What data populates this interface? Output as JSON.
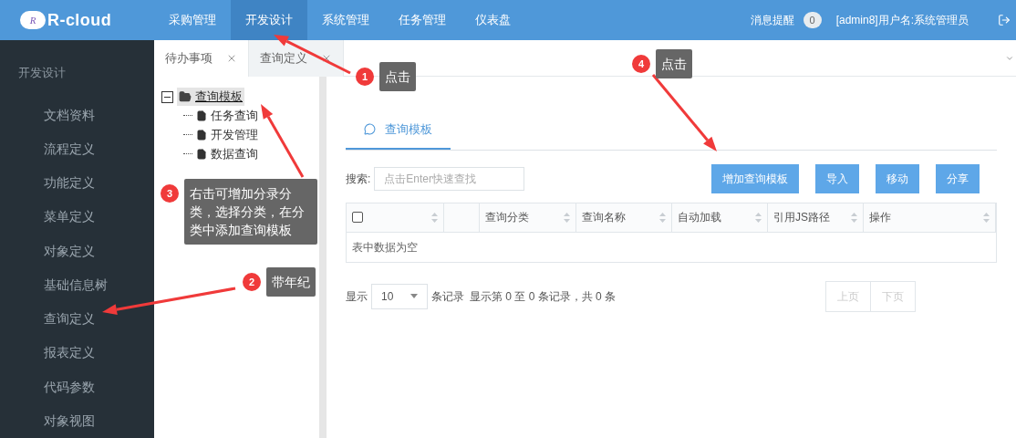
{
  "header": {
    "logo": {
      "mark": "R",
      "name": "R-cloud"
    },
    "nav": [
      {
        "label": "采购管理",
        "selected": false
      },
      {
        "label": "开发设计",
        "selected": true
      },
      {
        "label": "系统管理",
        "selected": false
      },
      {
        "label": "任务管理",
        "selected": false
      },
      {
        "label": "仪表盘",
        "selected": false
      }
    ],
    "notice": {
      "label": "消息提醒",
      "count": "0"
    },
    "user": "[admin8]用户名:系统管理员"
  },
  "sidebar": {
    "title": "开发设计",
    "items": [
      {
        "label": "文档资料"
      },
      {
        "label": "流程定义"
      },
      {
        "label": "功能定义"
      },
      {
        "label": "菜单定义"
      },
      {
        "label": "对象定义"
      },
      {
        "label": "基础信息树"
      },
      {
        "label": "查询定义"
      },
      {
        "label": "报表定义"
      },
      {
        "label": "代码参数"
      },
      {
        "label": "对象视图"
      }
    ]
  },
  "tabs": [
    {
      "label": "待办事项",
      "selected": false
    },
    {
      "label": "查询定义",
      "selected": true
    }
  ],
  "tree": {
    "label": "查询模板",
    "expanded": true,
    "selected": true,
    "children": [
      {
        "label": "任务查询"
      },
      {
        "label": "开发管理"
      },
      {
        "label": "数据查询"
      }
    ]
  },
  "panel": {
    "tab": "查询模板",
    "search": {
      "label": "搜索:",
      "placeholder": "点击Enter快速查找"
    },
    "buttons": [
      "增加查询模板",
      "导入",
      "移动",
      "分享"
    ],
    "table": {
      "columns": [
        {
          "kind": "checkbox",
          "checked": false
        },
        {
          "kind": "blank"
        },
        {
          "label": "查询分类",
          "kind": "text"
        },
        {
          "label": "查询名称",
          "kind": "text"
        },
        {
          "label": "自动加载",
          "kind": "text"
        },
        {
          "label": "引用JS路径",
          "kind": "text"
        },
        {
          "label": "操作",
          "kind": "text"
        }
      ],
      "empty": "表中数据为空"
    },
    "pager": {
      "show": "显示",
      "size": "10",
      "unit": "条记录",
      "info": "显示第 0 至 0 条记录，共 0 条",
      "prev": {
        "label": "上页",
        "disabled": true
      },
      "next": {
        "label": "下页",
        "disabled": true
      }
    }
  },
  "annotations": [
    {
      "number": "4",
      "text": "点击"
    },
    {
      "number": "1",
      "text": "点击"
    },
    {
      "number": "3",
      "text": "右击可增加分录分类，选择分类，在分类中添加查询模板"
    },
    {
      "number": "2",
      "text": "带年纪"
    }
  ]
}
